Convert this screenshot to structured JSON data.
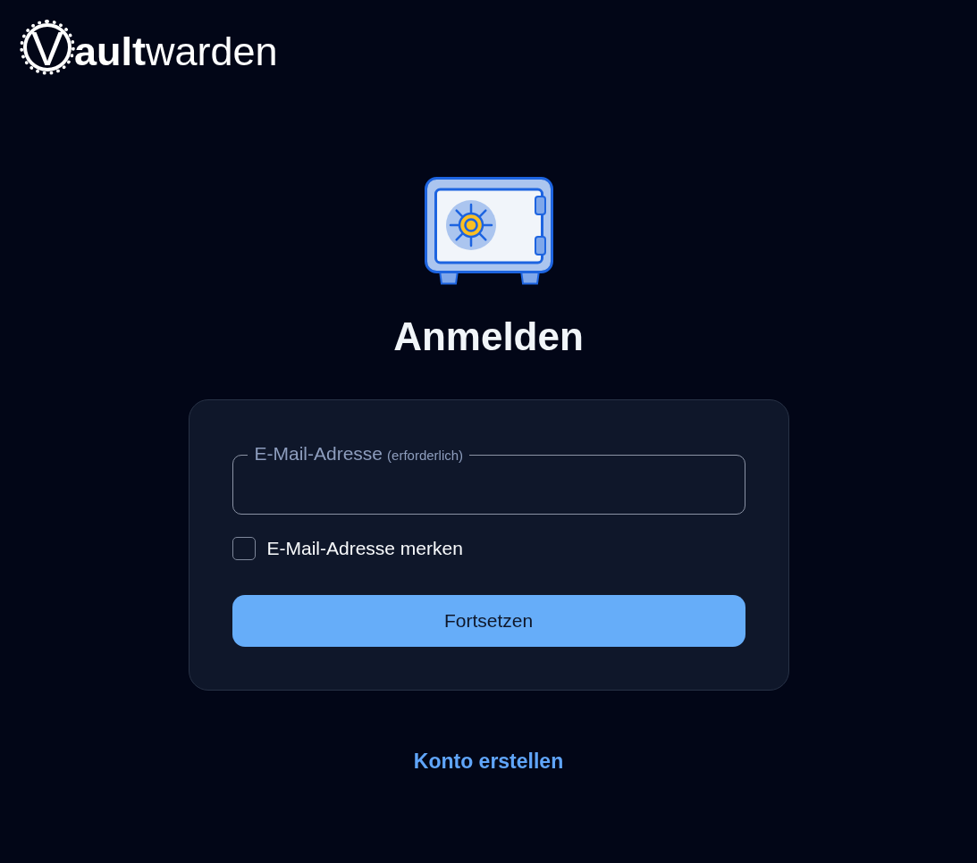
{
  "logo": {
    "mark_letter": "V",
    "wordmark": "**ault**warden"
  },
  "heading": "Anmelden",
  "form": {
    "email_field": {
      "label": "E-Mail-Adresse",
      "note": "(erforderlich)"
    },
    "remember_checkbox": {
      "label": "E-Mail-Adresse merken",
      "checked": false
    },
    "submit_button": "Fortsetzen"
  },
  "create_account_link": "Konto erstellen"
}
